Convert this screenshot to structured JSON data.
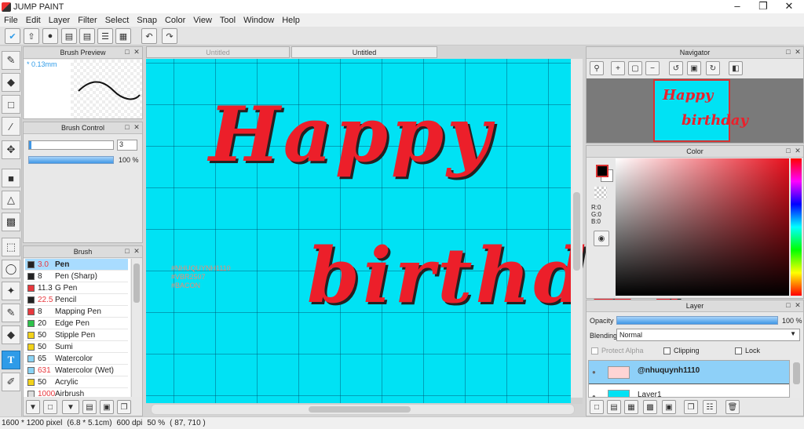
{
  "app": {
    "title": "JUMP PAINT"
  },
  "menu": [
    "File",
    "Edit",
    "Layer",
    "Filter",
    "Select",
    "Snap",
    "Color",
    "View",
    "Tool",
    "Window",
    "Help"
  ],
  "tabs": [
    "Untitled",
    "Untitled"
  ],
  "brush_preview": {
    "title": "Brush Preview",
    "size": "* 0.13mm"
  },
  "brush_control": {
    "title": "Brush Control",
    "size_value": "3",
    "opacity_value": "100 %"
  },
  "brush_list": {
    "title": "Brush",
    "items": [
      {
        "size": "3.0",
        "name": "Pen",
        "color": "#222222"
      },
      {
        "size": "8",
        "name": "Pen (Sharp)",
        "color": "#222222"
      },
      {
        "size": "11.3",
        "name": "G Pen",
        "color": "#e8383d"
      },
      {
        "size": "22.5",
        "name": "Pencil",
        "color": "#222222"
      },
      {
        "size": "8",
        "name": "Mapping Pen",
        "color": "#e8383d"
      },
      {
        "size": "20",
        "name": "Edge Pen",
        "color": "#2cc24a"
      },
      {
        "size": "50",
        "name": "Stipple Pen",
        "color": "#f2d21a"
      },
      {
        "size": "50",
        "name": "Sumi",
        "color": "#f2d21a"
      },
      {
        "size": "65",
        "name": "Watercolor",
        "color": "#8ad3f5"
      },
      {
        "size": "631",
        "name": "Watercolor (Wet)",
        "color": "#8ad3f5"
      },
      {
        "size": "50",
        "name": "Acrylic",
        "color": "#f2d21a"
      },
      {
        "size": "1000",
        "name": "Airbrush",
        "color": "#dddddd"
      }
    ]
  },
  "canvas": {
    "line1": "Happy",
    "line2": "birthday",
    "watermark": [
      "#NHUQUYNH1110",
      "#VBR2507",
      "#BACON"
    ]
  },
  "navigator": {
    "title": "Navigator",
    "line1": "Happy",
    "line2": "birthday"
  },
  "color_panel": {
    "title": "Color",
    "r": "R:0",
    "g": "G:0",
    "b": "B:0"
  },
  "layer_panel": {
    "title": "Layer",
    "opacity_label": "Opacity",
    "opacity_value": "100 %",
    "blending_label": "Blending",
    "blending_value": "Normal",
    "protect_alpha": "Protect Alpha",
    "clipping": "Clipping",
    "lock": "Lock",
    "layers": [
      "@nhuquynh1110",
      "Layer1"
    ]
  },
  "status": {
    "size": "1600 * 1200 pixel",
    "cm": "(6.8 * 5.1cm)",
    "dpi": "600 dpi",
    "zoom": "50 %",
    "pos": "( 87, 710 )"
  },
  "colors": {
    "canvas": "#00e2f4",
    "lettering": "#ec1f2a",
    "accent": "#2e9be8"
  }
}
